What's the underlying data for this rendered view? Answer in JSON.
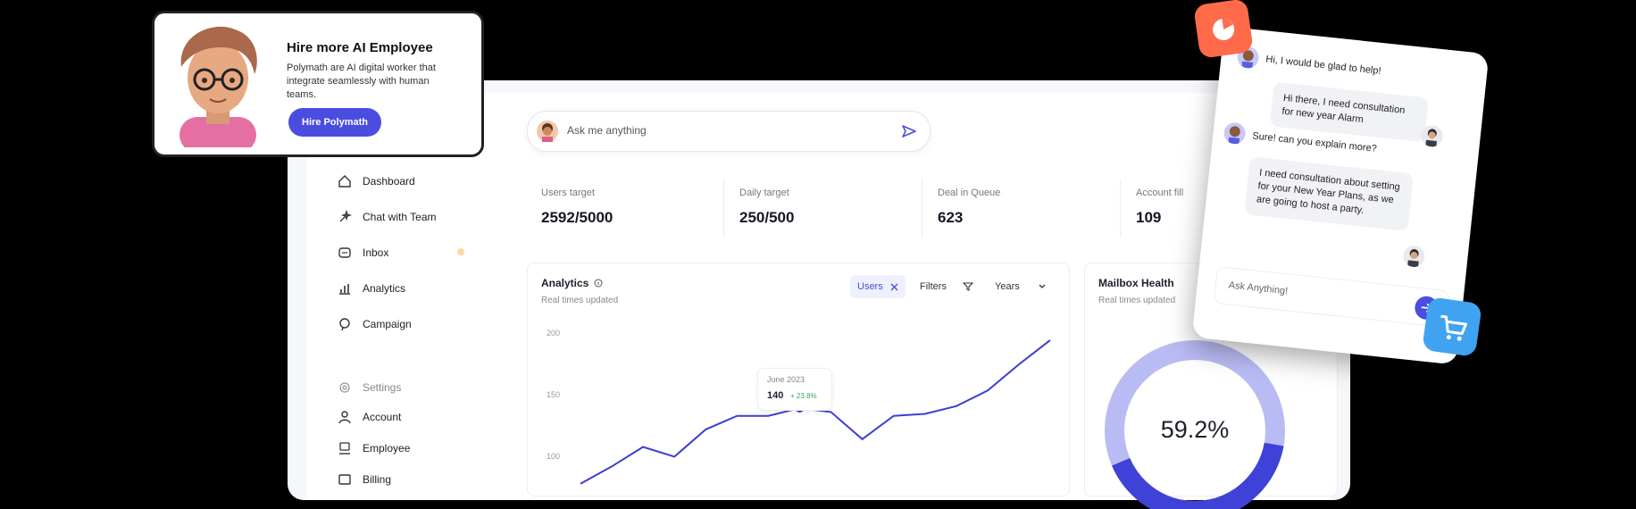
{
  "colors": {
    "accent": "#4a4de0",
    "chart_line": "#3b3fd0",
    "donut_light": "#b9bbf4",
    "donut_dark": "#3f42d6",
    "orange": "#ff6b4a",
    "blue": "#3fa3f2",
    "positive": "#3aa55b"
  },
  "hire_card": {
    "title": "Hire more AI Employee",
    "description": "Polymath are AI digital worker that integrate seamlessly with human teams.",
    "button": "Hire Polymath"
  },
  "search": {
    "placeholder": "Ask me anything"
  },
  "sidebar": {
    "items": [
      {
        "label": "Dashboard",
        "icon": "home-icon"
      },
      {
        "label": "Chat with Team",
        "icon": "magic-icon"
      },
      {
        "label": "Inbox",
        "icon": "inbox-icon"
      },
      {
        "label": "Analytics",
        "icon": "chart-icon"
      },
      {
        "label": "Campaign",
        "icon": "campaign-icon"
      }
    ],
    "section_label": "Settings",
    "settings_items": [
      {
        "label": "Account",
        "icon": "user-icon"
      },
      {
        "label": "Employee",
        "icon": "employee-icon"
      },
      {
        "label": "Billing",
        "icon": "billing-icon"
      }
    ]
  },
  "stats": [
    {
      "label": "Users target",
      "value": "2592/5000"
    },
    {
      "label": "Daily target",
      "value": "250/500"
    },
    {
      "label": "Deal in Queue",
      "value": "623"
    },
    {
      "label": "Account fill",
      "value": "109"
    }
  ],
  "analytics": {
    "title": "Analytics",
    "info_icon": "info-icon",
    "subtitle": "Real times updated",
    "filters": [
      {
        "label": "Users",
        "icon": "close-icon",
        "active": true
      },
      {
        "label": "Filters",
        "icon": "filter-icon",
        "active": false
      },
      {
        "label": "Years",
        "icon": "chevron-down-icon",
        "active": false
      }
    ],
    "y_ticks": [
      "200",
      "150",
      "100"
    ],
    "tooltip": {
      "label": "June 2023",
      "value": "140",
      "change": "+ 23.8%"
    }
  },
  "chart_data": {
    "type": "line",
    "title": "",
    "xlabel": "",
    "ylabel": "",
    "ylim": [
      60,
      220
    ],
    "x": [
      1,
      2,
      3,
      4,
      5,
      6,
      7,
      8,
      9,
      10,
      11,
      12,
      13,
      14,
      15,
      16
    ],
    "series": [
      {
        "values": [
          62,
          80,
          100,
          90,
          118,
          132,
          132,
          140,
          136,
          108,
          132,
          134,
          142,
          158,
          185,
          210
        ]
      }
    ],
    "highlight_index": 7
  },
  "mailbox": {
    "title": "Mailbox Health",
    "subtitle": "Real times updated",
    "percent_label": "59.2%",
    "percent": 59.2
  },
  "chat": {
    "messages": [
      {
        "from": "ai",
        "text": "Hi, I would be glad to help!"
      },
      {
        "from": "user",
        "text": "Hi there, I need consultation for new year Alarm"
      },
      {
        "from": "ai",
        "text": "Sure! can you explain more?"
      },
      {
        "from": "user",
        "text": "I need consultation about setting for your New Year Plans, as we are going to host a party."
      }
    ],
    "input_placeholder": "Ask Anything!"
  },
  "floating_icons": [
    {
      "name": "pie-chart-icon",
      "color": "#ff6b4a"
    },
    {
      "name": "cart-icon",
      "color": "#3fa3f2"
    }
  ]
}
